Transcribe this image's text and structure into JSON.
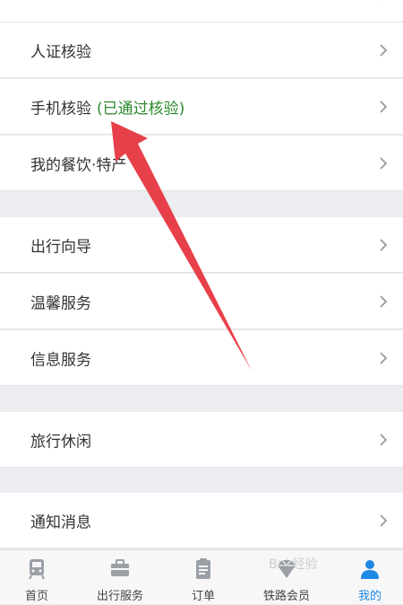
{
  "menu": {
    "items": [
      {
        "label": "人证核验"
      },
      {
        "label": "手机核验",
        "status": "(已通过核验)"
      },
      {
        "label": "我的餐饮·特产"
      },
      {
        "label": "出行向导"
      },
      {
        "label": "温馨服务"
      },
      {
        "label": "信息服务"
      },
      {
        "label": "旅行休闲"
      },
      {
        "label": "通知消息"
      }
    ]
  },
  "tabbar": {
    "tabs": [
      {
        "label": "首页",
        "icon": "train-icon"
      },
      {
        "label": "出行服务",
        "icon": "briefcase-icon"
      },
      {
        "label": "订单",
        "icon": "clipboard-icon"
      },
      {
        "label": "铁路会员",
        "icon": "diamond-icon"
      },
      {
        "label": "我的",
        "icon": "user-icon",
        "active": true
      }
    ]
  },
  "colors": {
    "status_green": "#2b8a2b",
    "active_blue": "#1e88e5",
    "annotation_red": "#e8404a"
  },
  "watermark": "Bai 经验"
}
